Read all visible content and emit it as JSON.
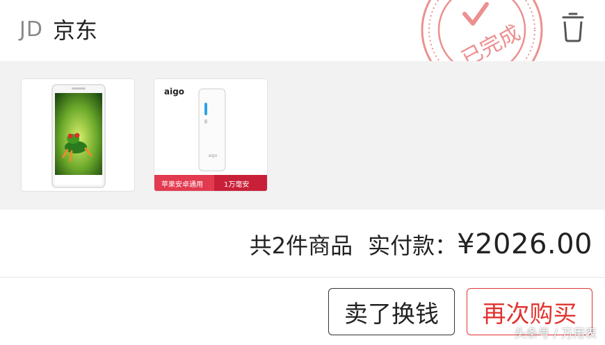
{
  "header": {
    "shop_logo": "JD",
    "shop_name": "京东",
    "stamp_text": "已完成",
    "trash_icon": "trash-icon"
  },
  "products": [
    {
      "name": "smartphone",
      "image": "phone-with-frog-wallpaper"
    },
    {
      "name": "power-bank",
      "image": "aigo-power-bank",
      "brand": "aigo",
      "banner_left": "苹果安卓通用",
      "banner_right": "1万毫安"
    }
  ],
  "summary": {
    "count": "共2件商品",
    "paid_label": "实付款：",
    "price": "¥2026.00"
  },
  "actions": {
    "sell_label": "卖了换钱",
    "rebuy_label": "再次购买"
  },
  "watermark": "头条号 / 万用表",
  "colors": {
    "accent_red": "#e0332f",
    "stamp_red": "#ec8f8f",
    "product_bg": "#f2f2f2"
  }
}
